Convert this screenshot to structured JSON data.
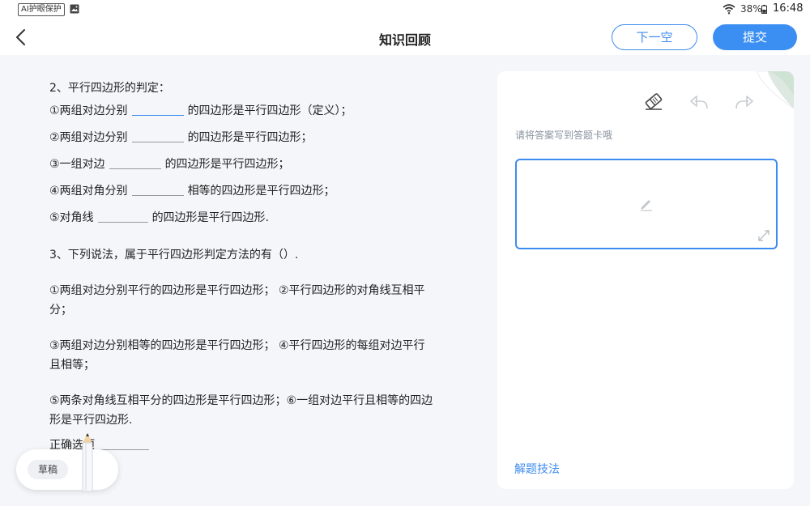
{
  "status_bar": {
    "ai_badge": "AI护眼保护",
    "battery": "38%",
    "time": "16:48",
    "icons": [
      "image-icon",
      "wifi-icon",
      "battery-icon"
    ]
  },
  "header": {
    "title": "知识回顾",
    "next_blank": "下一空",
    "submit": "提交",
    "icons": [
      "back-arrow-icon"
    ]
  },
  "question": {
    "q2": {
      "heading": "2、平行四边形的判定：",
      "items": [
        {
          "before": "①两组对边分别",
          "after": "的四边形是平行四边形（定义）；"
        },
        {
          "before": "②两组对边分别",
          "after": "的四边形是平行四边形；"
        },
        {
          "before": "③一组对边",
          "after": "的四边形是平行四边形；"
        },
        {
          "before": "④两组对角分别",
          "after": "相等的四边形是平行四边形；"
        },
        {
          "before": "⑤对角线",
          "after": "的四边形是平行四边形."
        }
      ]
    },
    "q3": {
      "heading": "3、下列说法，属于平行四边形判定方法的有（）.",
      "lines": [
        "①两组对边分别平行的四边形是平行四边形；  ②平行四边形的对角线互相平",
        "分；",
        "③两组对边分别相等的四边形是平行四边形；  ④平行四边形的每组对边平行",
        "且相等；",
        "⑤两条对角线互相平分的四边形是平行四边形；⑥一组对边平行且相等的四边",
        "形是平行四边形."
      ],
      "answer_label": "正确选项"
    }
  },
  "draft": {
    "label": "草稿",
    "icons": [
      "pencil-icon"
    ]
  },
  "answer_card": {
    "hint": "请将答案写到答题卡哦",
    "solution_tips": "解题技法",
    "icons": [
      "eraser-icon",
      "undo-icon",
      "redo-icon",
      "edit-icon",
      "expand-icon"
    ]
  },
  "colors": {
    "accent": "#3d8bf0",
    "page_background": "#f4f6f9"
  }
}
